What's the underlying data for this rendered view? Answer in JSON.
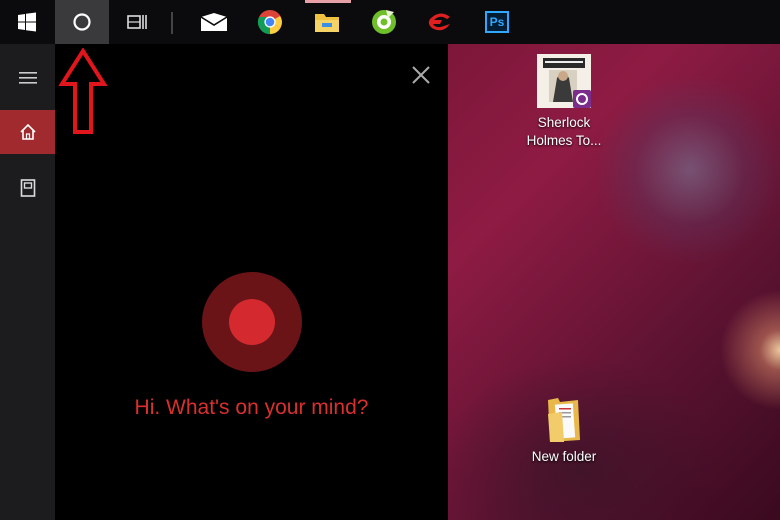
{
  "taskbar": {
    "apps": [
      {
        "icon": "windows-start-icon"
      },
      {
        "icon": "cortana-search-icon",
        "active": true
      },
      {
        "icon": "task-view-icon"
      },
      {
        "icon": "mail-icon"
      },
      {
        "icon": "chrome-icon"
      },
      {
        "icon": "file-explorer-icon"
      },
      {
        "icon": "green-app-icon"
      },
      {
        "icon": "garena-icon"
      },
      {
        "icon": "photoshop-icon",
        "text": "Ps"
      }
    ]
  },
  "cortana": {
    "greeting": "Hi. What's on your mind?",
    "nav": [
      {
        "icon": "hamburger-menu-icon"
      },
      {
        "icon": "home-icon",
        "active": true
      },
      {
        "icon": "notebook-icon"
      }
    ],
    "accent_color": "#d42a2f"
  },
  "desktop": {
    "icons": [
      {
        "label_line1": "Sherlock",
        "label_line2": "Holmes To...",
        "icon": "sherlock-game-icon"
      },
      {
        "label_line1": "New folder",
        "icon": "folder-icon"
      }
    ]
  }
}
